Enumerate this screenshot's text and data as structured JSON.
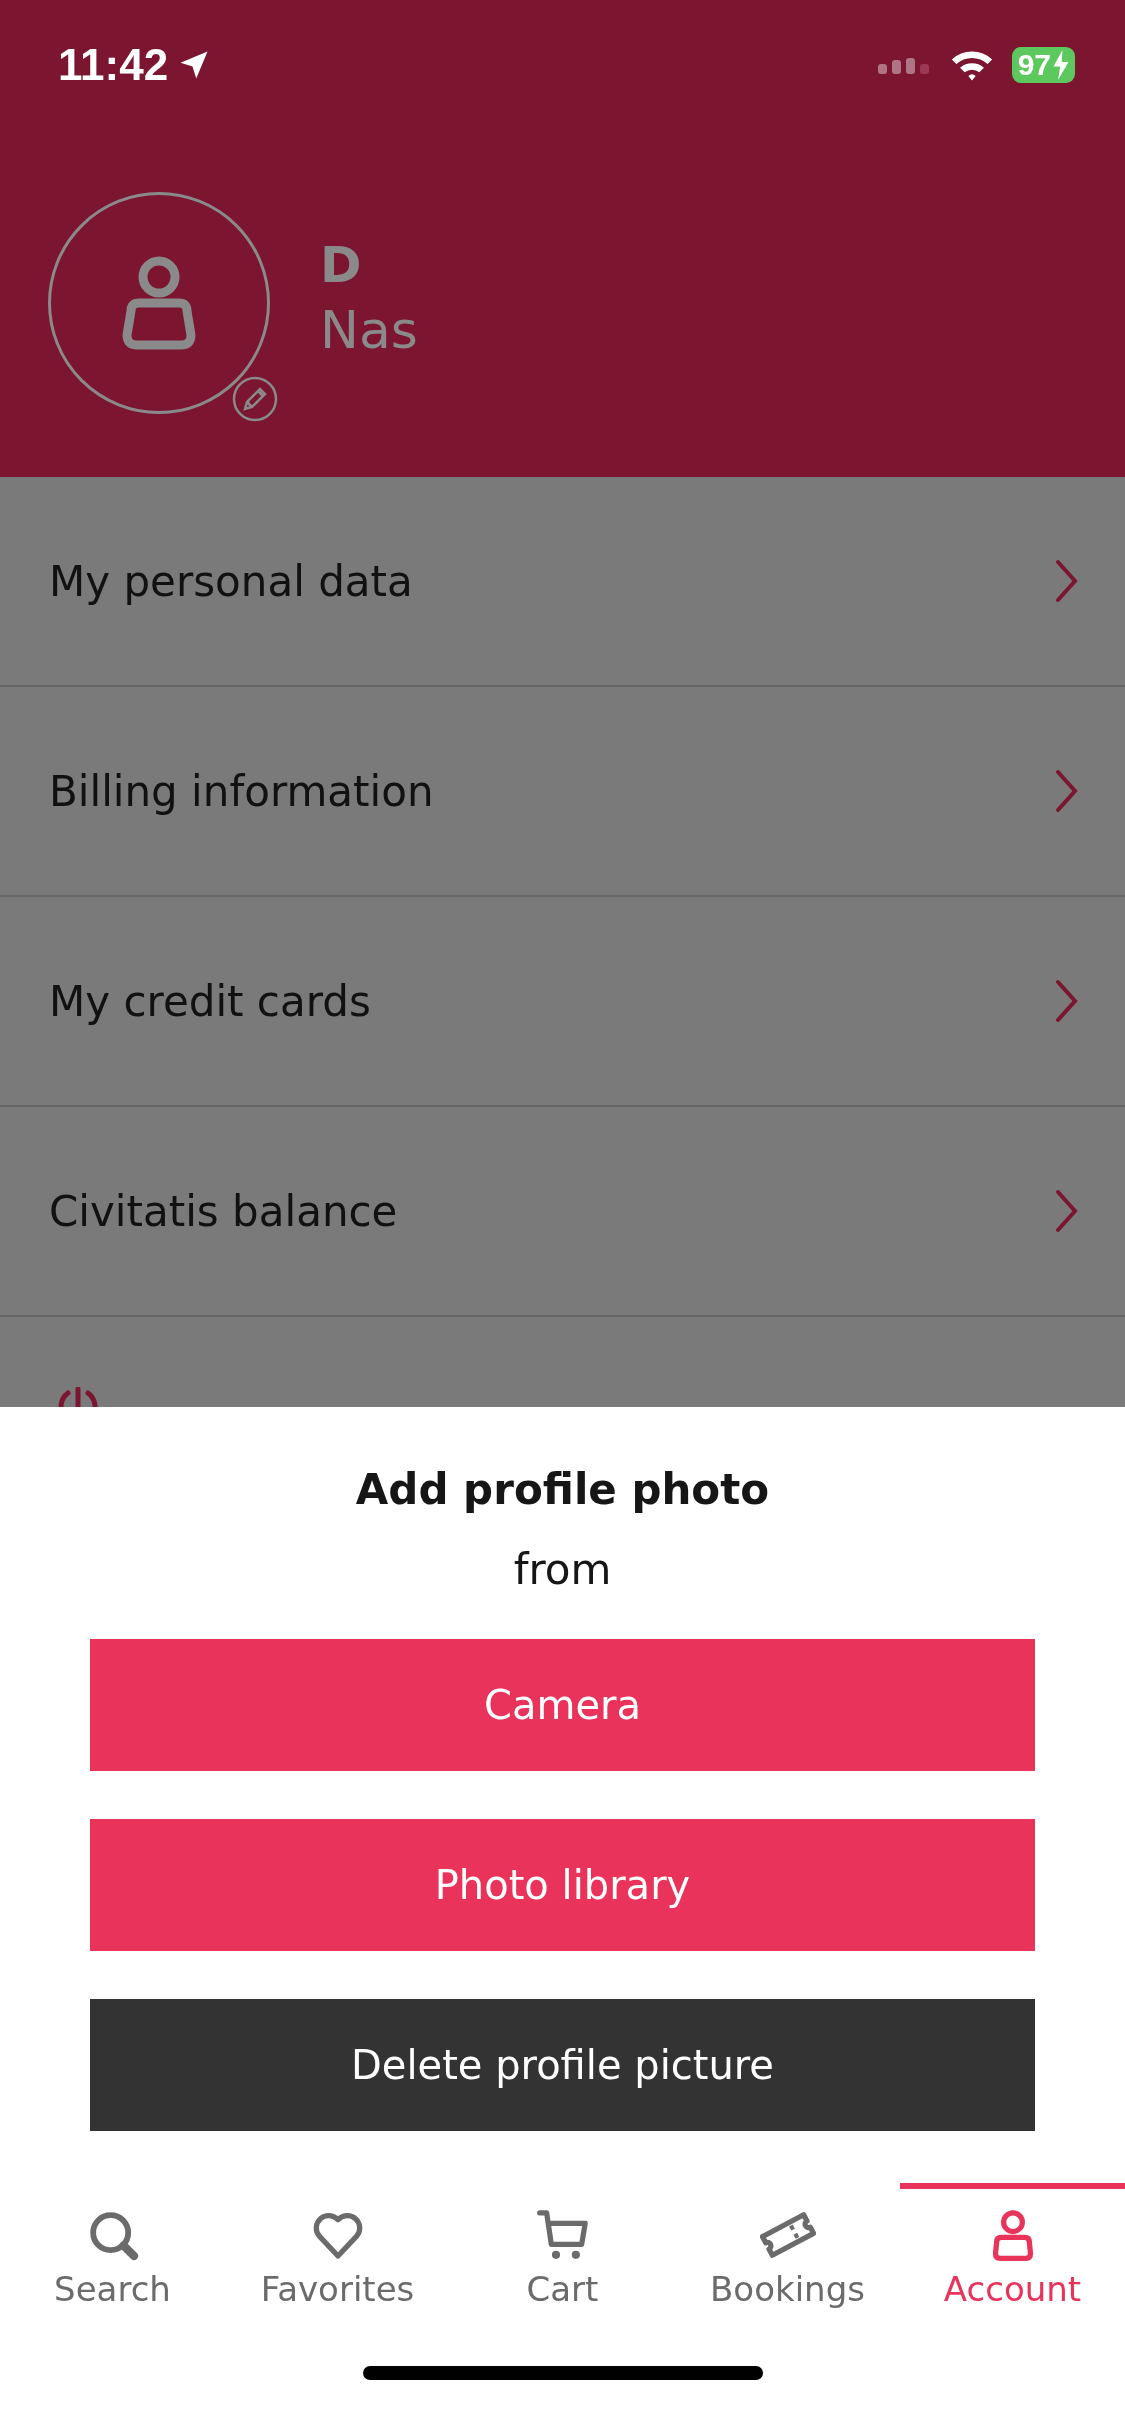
{
  "status_bar": {
    "time": "11:42",
    "battery": "97"
  },
  "profile": {
    "first_name": "D",
    "last_name": "Nas"
  },
  "menu": [
    {
      "label": "My personal data"
    },
    {
      "label": "Billing information"
    },
    {
      "label": "My credit cards"
    },
    {
      "label": "Civitatis balance"
    }
  ],
  "sheet": {
    "title": "Add profile photo",
    "subtitle": "from",
    "buttons": [
      {
        "label": "Camera",
        "kind": "primary"
      },
      {
        "label": "Photo library",
        "kind": "primary"
      },
      {
        "label": "Delete profile picture",
        "kind": "dark"
      }
    ]
  },
  "tabs": [
    {
      "label": "Search",
      "selected": false
    },
    {
      "label": "Favorites",
      "selected": false
    },
    {
      "label": "Cart",
      "selected": false
    },
    {
      "label": "Bookings",
      "selected": false
    },
    {
      "label": "Account",
      "selected": true
    }
  ]
}
